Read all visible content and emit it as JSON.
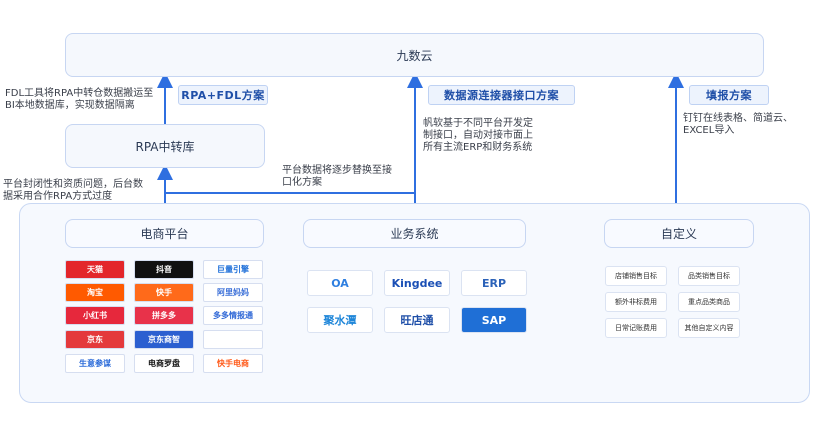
{
  "top": {
    "title": "九数云"
  },
  "left": {
    "tag": "RPA+FDL方案",
    "note_lines": [
      "FDL工具将RPA中转仓数据搬运至",
      "BI本地数据库，实现数据隔离"
    ],
    "hub": "RPA中转库",
    "bottom_note_lines": [
      "平台封闭性和资质问题，后台数",
      "据采用合作RPA方式过度"
    ]
  },
  "middle": {
    "tag": "数据源连接器接口方案",
    "note_lines": [
      "帆软基于不同平台开发定",
      "制接口，自动对接市面上",
      "所有主流ERP和财务系统"
    ],
    "replace_note_lines": [
      "平台数据将逐步替换至接",
      "口化方案"
    ]
  },
  "right": {
    "tag": "填报方案",
    "note_lines": [
      "钉钉在线表格、简道云、",
      "EXCEL导入"
    ]
  },
  "ecommerce": {
    "title": "电商平台",
    "logos": [
      {
        "label": "天猫",
        "bg": "#e3262b",
        "fg": "#ffffff"
      },
      {
        "label": "抖音",
        "bg": "#111111",
        "fg": "#ffffff"
      },
      {
        "label": "巨量引擎",
        "bg": "#ffffff",
        "fg": "#1e6fd9"
      },
      {
        "label": "淘宝",
        "bg": "#ff5a00",
        "fg": "#ffffff"
      },
      {
        "label": "快手",
        "bg": "#ff6a1a",
        "fg": "#ffffff"
      },
      {
        "label": "阿里妈妈",
        "bg": "#ffffff",
        "fg": "#3a6fd8"
      },
      {
        "label": "小红书",
        "bg": "#e6283c",
        "fg": "#ffffff"
      },
      {
        "label": "拼多多",
        "bg": "#e8324a",
        "fg": "#ffffff"
      },
      {
        "label": "多多情报通",
        "bg": "#ffffff",
        "fg": "#2e67d6"
      },
      {
        "label": "京东",
        "bg": "#e4393c",
        "fg": "#ffffff"
      },
      {
        "label": "京东商智",
        "bg": "#2b5fd0",
        "fg": "#ffffff"
      },
      {
        "label": "",
        "bg": "#ffffff",
        "fg": "#333333"
      },
      {
        "label": "生意参谋",
        "bg": "#ffffff",
        "fg": "#2a6ad8"
      },
      {
        "label": "电商罗盘",
        "bg": "#ffffff",
        "fg": "#111111"
      },
      {
        "label": "快手电商",
        "bg": "#ffffff",
        "fg": "#ff5a1a"
      }
    ]
  },
  "business": {
    "title": "业务系统",
    "logos": [
      {
        "label": "OA",
        "bg": "#ffffff",
        "fg": "#2f7fe0"
      },
      {
        "label": "Kingdee",
        "bg": "#ffffff",
        "fg": "#1a4fb5"
      },
      {
        "label": "ERP",
        "bg": "#ffffff",
        "fg": "#2b62b8"
      },
      {
        "label": "聚水潭",
        "bg": "#ffffff",
        "fg": "#1e86d9"
      },
      {
        "label": "旺店通",
        "bg": "#ffffff",
        "fg": "#1f4fa8"
      },
      {
        "label": "SAP",
        "bg": "#1f6fd6",
        "fg": "#ffffff"
      }
    ]
  },
  "custom": {
    "title": "自定义",
    "items": [
      "店铺销售目标",
      "品类销售目标",
      "额外非标费用",
      "重点品类商品",
      "日常记账费用",
      "其他自定义内容"
    ]
  }
}
